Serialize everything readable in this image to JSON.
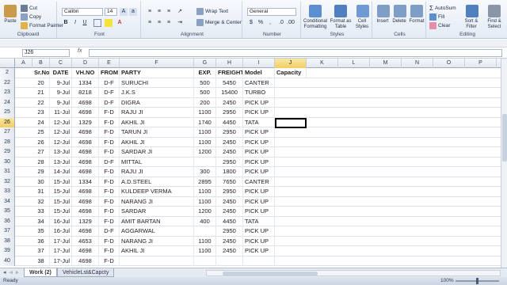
{
  "ribbon": {
    "clipboard": {
      "label": "Clipboard",
      "paste": "Paste",
      "cut": "Cut",
      "copy": "Copy",
      "format_painter": "Format Painter"
    },
    "font": {
      "label": "Font",
      "name": "Calibri",
      "size": "14",
      "bold": "B",
      "italic": "I",
      "underline": "U"
    },
    "alignment": {
      "label": "Alignment",
      "wrap_text": "Wrap Text",
      "merge_center": "Merge & Center"
    },
    "number": {
      "label": "Number",
      "format": "General",
      "currency": "$",
      "percent": "%",
      "comma": ","
    },
    "styles": {
      "label": "Styles",
      "conditional": "Conditional Formatting",
      "format_table": "Format as Table",
      "cell_styles": "Cell Styles"
    },
    "cells": {
      "label": "Cells",
      "insert": "Insert",
      "delete": "Delete",
      "format": "Format"
    },
    "editing": {
      "label": "Editing",
      "autosum": "AutoSum",
      "fill": "Fill",
      "clear": "Clear",
      "sort_filter": "Sort & Filter",
      "find_select": "Find & Select"
    }
  },
  "formula_bar": {
    "name_box": "J26",
    "fx": "fx",
    "content": ""
  },
  "columns": [
    "A",
    "B",
    "C",
    "D",
    "E",
    "F",
    "G",
    "H",
    "I",
    "J",
    "K",
    "L",
    "M",
    "N",
    "O",
    "P",
    "Q"
  ],
  "active_column": "J",
  "header_row": {
    "row_number": "2",
    "cells": {
      "sr": "Sr.No",
      "date": "DATE",
      "vh": "VH.NO",
      "from": "FROM",
      "party": "PARTY",
      "exp": "EXP.",
      "freight": "FREIGHT",
      "model": "Model",
      "capacity": "Capacity"
    }
  },
  "rows": [
    {
      "n": "22",
      "sr": "20",
      "date": "9-Jul",
      "vh": "1334",
      "from": "D-F",
      "party": "SURUCHI",
      "exp": "500",
      "freight": "5450",
      "model": "CANTER"
    },
    {
      "n": "23",
      "sr": "21",
      "date": "9-Jul",
      "vh": "8218",
      "from": "D-F",
      "party": "J.K.S",
      "exp": "500",
      "freight": "15400",
      "model": "TURBO"
    },
    {
      "n": "24",
      "sr": "22",
      "date": "9-Jul",
      "vh": "4698",
      "from": "D-F",
      "party": "DIGRA",
      "exp": "200",
      "freight": "2450",
      "model": "PICK UP"
    },
    {
      "n": "25",
      "sr": "23",
      "date": "11-Jul",
      "vh": "4698",
      "from": "F-D",
      "party": "RAJU JI",
      "exp": "1100",
      "freight": "2950",
      "model": "PICK UP"
    },
    {
      "n": "26",
      "sr": "24",
      "date": "12-Jul",
      "vh": "1329",
      "from": "F-D",
      "party": "AKHIL JI",
      "exp": "1740",
      "freight": "4450",
      "model": "TATA"
    },
    {
      "n": "27",
      "sr": "25",
      "date": "12-Jul",
      "vh": "4698",
      "from": "F-D",
      "party": "TARUN JI",
      "exp": "1100",
      "freight": "2950",
      "model": "PICK UP"
    },
    {
      "n": "28",
      "sr": "26",
      "date": "12-Jul",
      "vh": "4698",
      "from": "F-D",
      "party": "AKHIL JI",
      "exp": "1100",
      "freight": "2450",
      "model": "PICK UP"
    },
    {
      "n": "29",
      "sr": "27",
      "date": "13-Jul",
      "vh": "4698",
      "from": "F-D",
      "party": "SARDAR JI",
      "exp": "1200",
      "freight": "2450",
      "model": "PICK UP"
    },
    {
      "n": "30",
      "sr": "28",
      "date": "13-Jul",
      "vh": "4698",
      "from": "D-F",
      "party": "MITTAL",
      "exp": "",
      "freight": "2950",
      "model": "PICK UP"
    },
    {
      "n": "31",
      "sr": "29",
      "date": "14-Jul",
      "vh": "4698",
      "from": "F-D",
      "party": "RAJU JI",
      "exp": "300",
      "freight": "1800",
      "model": "PICK UP"
    },
    {
      "n": "32",
      "sr": "30",
      "date": "15-Jul",
      "vh": "1334",
      "from": "F-D",
      "party": "A.D.STEEL",
      "exp": "2895",
      "freight": "7650",
      "model": "CANTER"
    },
    {
      "n": "33",
      "sr": "31",
      "date": "15-Jul",
      "vh": "4698",
      "from": "F-D",
      "party": "KULDEEP VERMA",
      "exp": "1100",
      "freight": "2950",
      "model": "PICK UP"
    },
    {
      "n": "34",
      "sr": "32",
      "date": "15-Jul",
      "vh": "4698",
      "from": "F-D",
      "party": "NARANG JI",
      "exp": "1100",
      "freight": "2450",
      "model": "PICK UP"
    },
    {
      "n": "35",
      "sr": "33",
      "date": "15-Jul",
      "vh": "4698",
      "from": "F-D",
      "party": "SARDAR",
      "exp": "1200",
      "freight": "2450",
      "model": "PICK UP"
    },
    {
      "n": "36",
      "sr": "34",
      "date": "16-Jul",
      "vh": "1329",
      "from": "F-D",
      "party": "AMIT BARTAN",
      "exp": "400",
      "freight": "4450",
      "model": "TATA"
    },
    {
      "n": "37",
      "sr": "35",
      "date": "16-Jul",
      "vh": "4698",
      "from": "D-F",
      "party": "AGGARWAL",
      "exp": "",
      "freight": "2950",
      "model": "PICK UP"
    },
    {
      "n": "38",
      "sr": "36",
      "date": "17-Jul",
      "vh": "4653",
      "from": "F-D",
      "party": "NARANG JI",
      "exp": "1100",
      "freight": "2450",
      "model": "PICK UP"
    },
    {
      "n": "39",
      "sr": "37",
      "date": "17-Jul",
      "vh": "4698",
      "from": "F-D",
      "party": "AKHIL JI",
      "exp": "1100",
      "freight": "2450",
      "model": "PICK UP"
    },
    {
      "n": "40",
      "sr": "38",
      "date": "17-Jul",
      "vh": "4698",
      "from": "F-D",
      "party": "",
      "exp": "",
      "freight": "",
      "model": ""
    }
  ],
  "active_row": "26",
  "sheets": [
    {
      "name": "Work (2)",
      "active": true
    },
    {
      "name": "VehicleLst&Capcty",
      "active": false
    }
  ],
  "status": {
    "ready": "Ready",
    "zoom": "100%"
  }
}
